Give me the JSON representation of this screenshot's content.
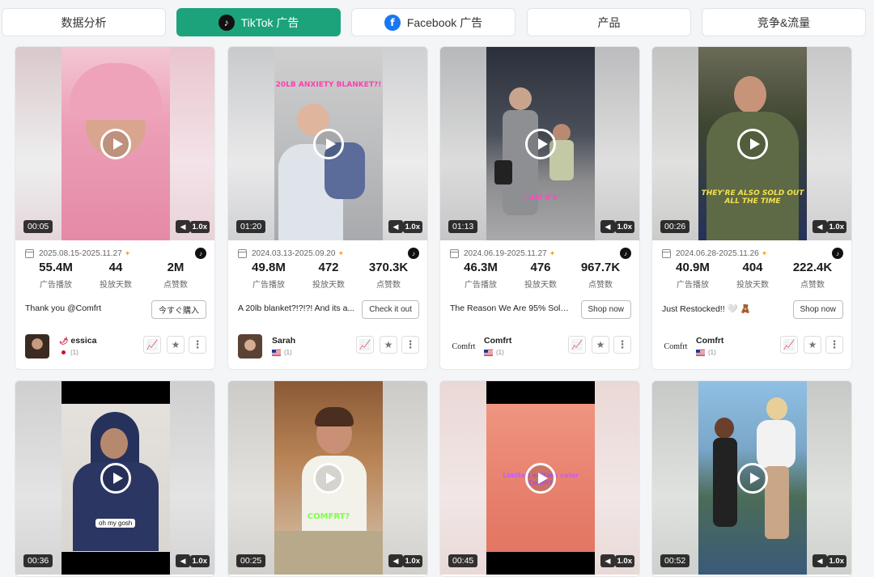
{
  "tabs": [
    {
      "label": "数据分析",
      "active": false,
      "icon": ""
    },
    {
      "label": "TikTok 广告",
      "active": true,
      "icon": "tiktok-icon"
    },
    {
      "label": "Facebook 广告",
      "active": false,
      "icon": "facebook-icon"
    },
    {
      "label": "产品",
      "active": false,
      "icon": ""
    },
    {
      "label": "竞争&流量",
      "active": false,
      "icon": ""
    }
  ],
  "stat_labels": {
    "plays": "广告播放",
    "days": "投放天数",
    "likes": "点赞数"
  },
  "speed_label": "1.0x",
  "colors": {
    "accent": "#1ca37c",
    "tiktok": "#111111",
    "facebook": "#1877f2"
  },
  "cards": [
    {
      "duration": "00:05",
      "date": "2025.08.15-2025.11.27",
      "plays": "55.4M",
      "days": "44",
      "likes": "2M",
      "caption": "Thank you @Comfrt",
      "cta": "今すぐ購入",
      "user": "essica",
      "user_prefix": "🌶",
      "country_count": "(1)"
    },
    {
      "duration": "01:20",
      "date": "2024.03.13-2025.09.20",
      "plays": "49.8M",
      "days": "472",
      "likes": "370.3K",
      "caption": "A 20lb blanket?!?!?! And its a...",
      "cta": "Check it out",
      "user": "Sarah",
      "country_count": "(1)",
      "overlay": "20LB ANXIETY BLANKET?!"
    },
    {
      "duration": "01:13",
      "date": "2024.06.19-2025.11.27",
      "plays": "46.3M",
      "days": "476",
      "likes": "967.7K",
      "caption": "The Reason We Are 95% Sold ...",
      "cta": "Shop now",
      "user": "Comfrt",
      "logo": "Comfrt",
      "country_count": "(1)",
      "overlay": "I AM 4'9"
    },
    {
      "duration": "00:26",
      "date": "2024.06.28-2025.11.26",
      "plays": "40.9M",
      "days": "404",
      "likes": "222.4K",
      "caption": "Just Restocked!! 🤍 🧸",
      "cta": "Shop now",
      "user": "Comfrt",
      "logo": "Comfrt",
      "country_count": "(1)",
      "overlay": "THEY'RE ALSO SOLD OUT ALL THE TIME"
    },
    {
      "duration": "00:36",
      "overlay": "oh my gosh"
    },
    {
      "duration": "00:25",
      "overlay": "COMFRT?"
    },
    {
      "duration": "00:45",
      "overlay": "Limited edition color Comfrt"
    },
    {
      "duration": "00:52"
    }
  ]
}
